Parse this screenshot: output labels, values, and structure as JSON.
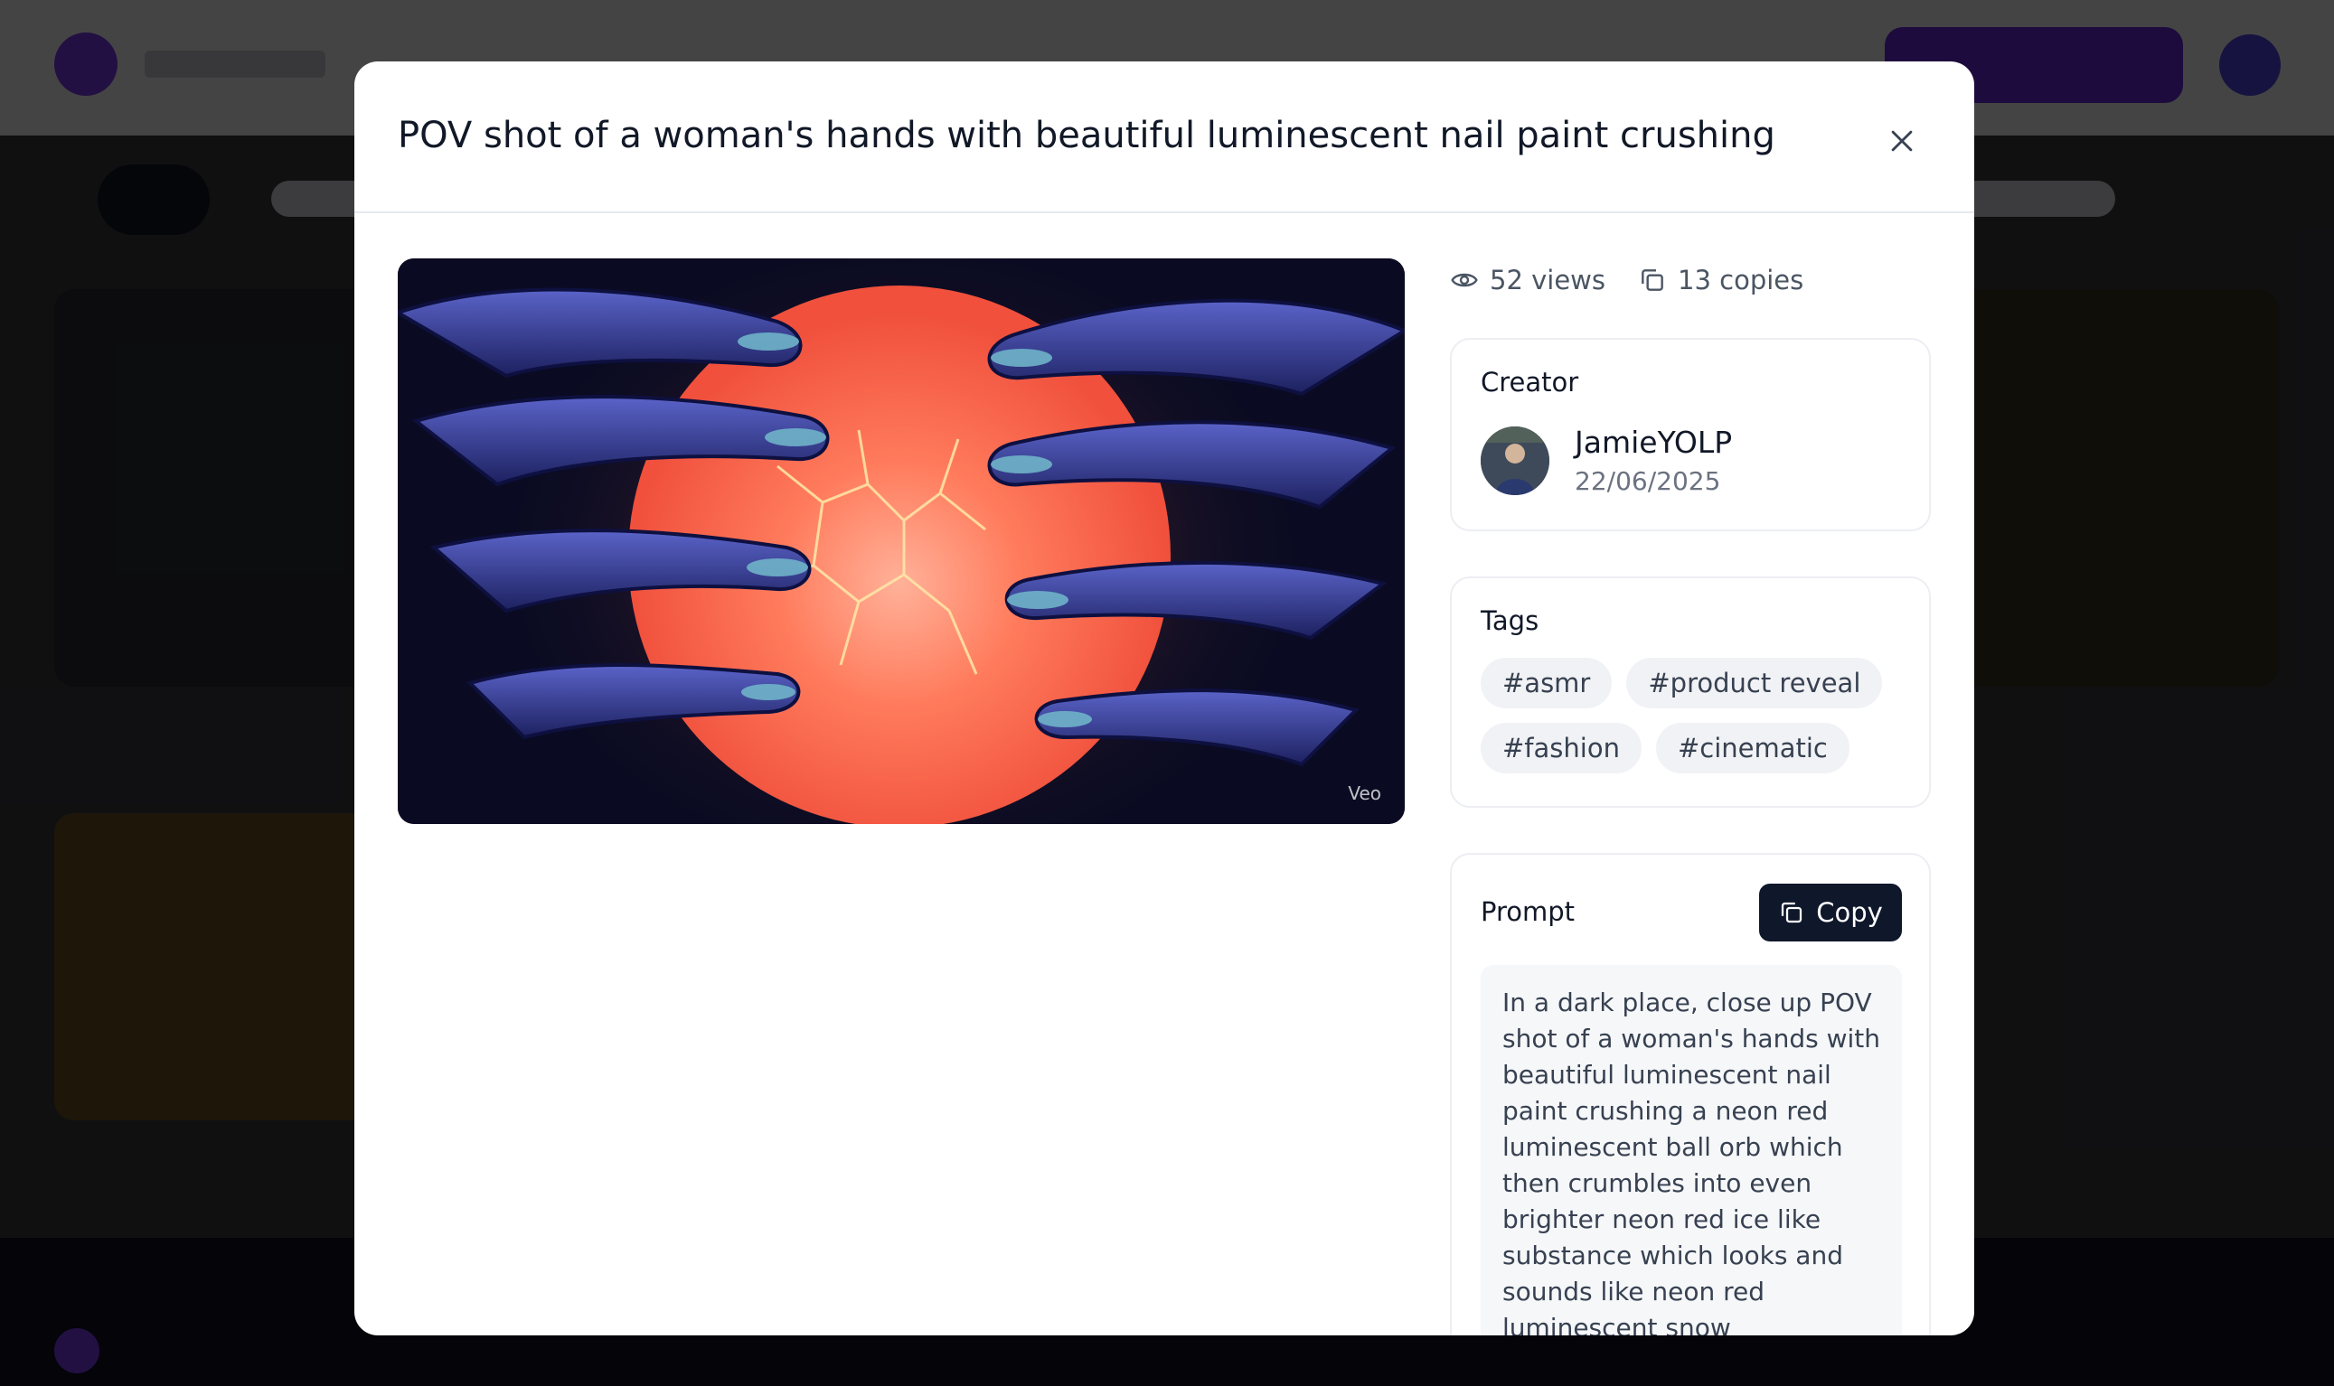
{
  "modal": {
    "title": "POV shot of a woman's hands with beautiful luminescent nail paint crushing",
    "close_icon": "close-icon",
    "media": {
      "watermark": "Veo"
    },
    "stats": {
      "views": "52 views",
      "copies": "13 copies"
    },
    "creator": {
      "label": "Creator",
      "name": "JamieYOLP",
      "date": "22/06/2025"
    },
    "tags": {
      "label": "Tags",
      "items": [
        "#asmr",
        "#product reveal",
        "#fashion",
        "#cinematic"
      ]
    },
    "prompt": {
      "label": "Prompt",
      "copy_label": "Copy",
      "text": "In a dark place, close up POV shot of a woman's hands with beautiful luminescent nail paint crushing a neon red luminescent ball orb which then crumbles into even brighter neon red ice like substance which looks and sounds like neon red luminescent snow"
    }
  },
  "colors": {
    "accent": "#0f172a",
    "brand": "#7c3aed",
    "overlay": "#000000"
  }
}
